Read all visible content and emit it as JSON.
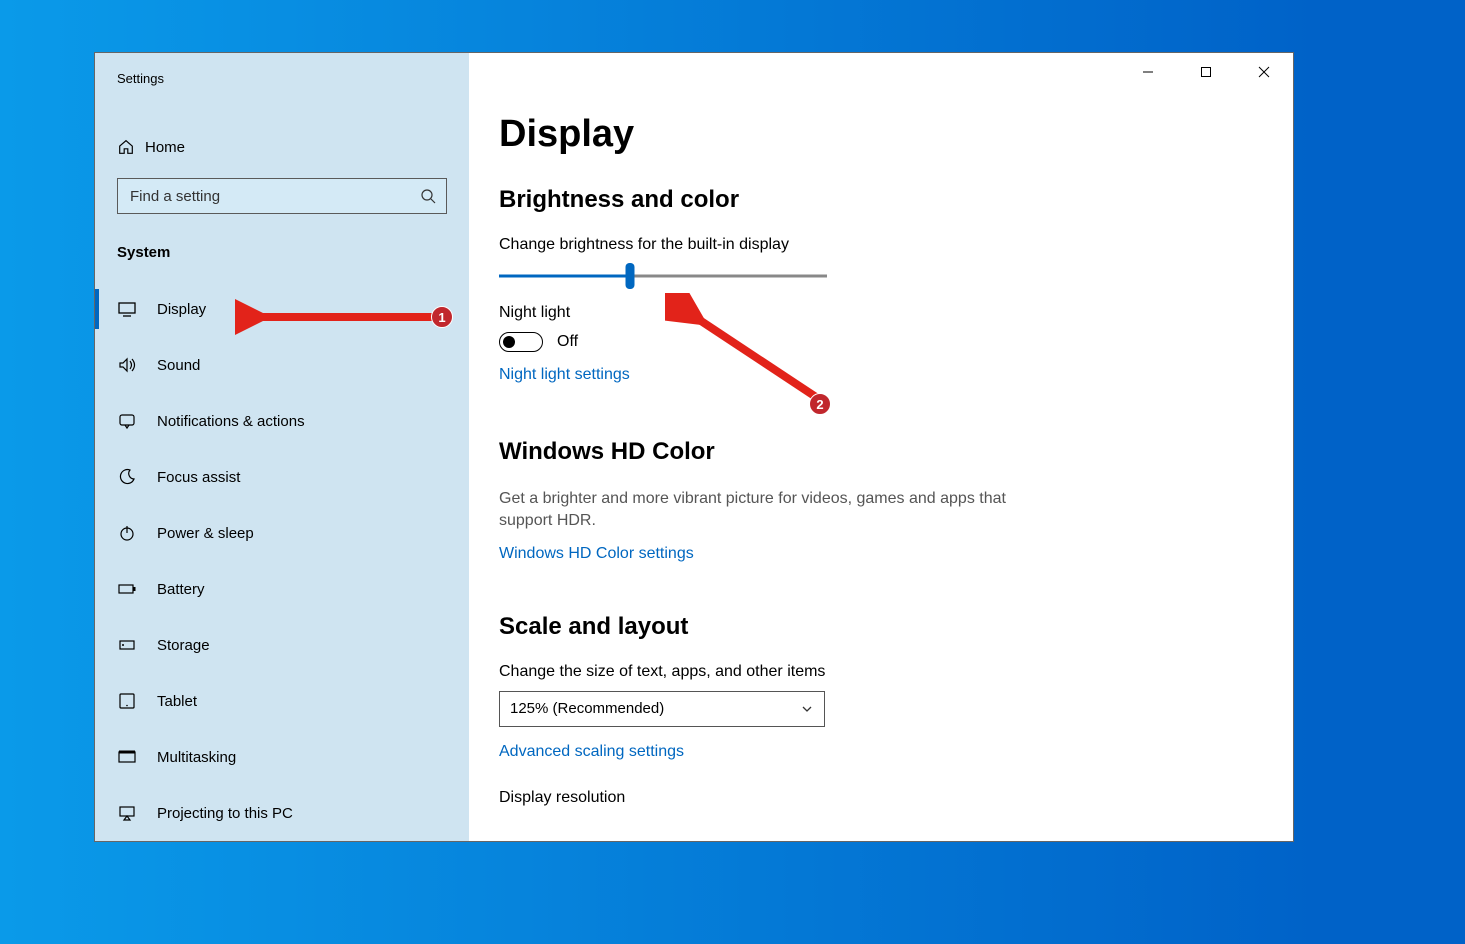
{
  "window": {
    "title": "Settings"
  },
  "titlebar": {
    "minimize": "–",
    "maximize": "▢",
    "close": "✕"
  },
  "home": {
    "label": "Home"
  },
  "search": {
    "placeholder": "Find a setting"
  },
  "section": {
    "label": "System"
  },
  "nav": [
    {
      "label": "Display",
      "icon": "display-icon",
      "selected": true
    },
    {
      "label": "Sound",
      "icon": "sound-icon",
      "selected": false
    },
    {
      "label": "Notifications & actions",
      "icon": "notify-icon",
      "selected": false
    },
    {
      "label": "Focus assist",
      "icon": "moon-icon",
      "selected": false
    },
    {
      "label": "Power & sleep",
      "icon": "power-icon",
      "selected": false
    },
    {
      "label": "Battery",
      "icon": "battery-icon",
      "selected": false
    },
    {
      "label": "Storage",
      "icon": "storage-icon",
      "selected": false
    },
    {
      "label": "Tablet",
      "icon": "tablet-icon",
      "selected": false
    },
    {
      "label": "Multitasking",
      "icon": "multitask-icon",
      "selected": false
    },
    {
      "label": "Projecting to this PC",
      "icon": "project-icon",
      "selected": false
    }
  ],
  "page": {
    "title": "Display",
    "brightness": {
      "heading": "Brightness and color",
      "slider_label": "Change brightness for the built-in display",
      "slider_percent": 40,
      "night_light_label": "Night light",
      "night_light_state": "Off",
      "night_light_link": "Night light settings"
    },
    "hdcolor": {
      "heading": "Windows HD Color",
      "desc": "Get a brighter and more vibrant picture for videos, games and apps that support HDR.",
      "link": "Windows HD Color settings"
    },
    "scale": {
      "heading": "Scale and layout",
      "size_label": "Change the size of text, apps, and other items",
      "size_value": "125% (Recommended)",
      "adv_link": "Advanced scaling settings",
      "res_label": "Display resolution"
    }
  },
  "annotations": {
    "marker1": "1",
    "marker2": "2"
  }
}
